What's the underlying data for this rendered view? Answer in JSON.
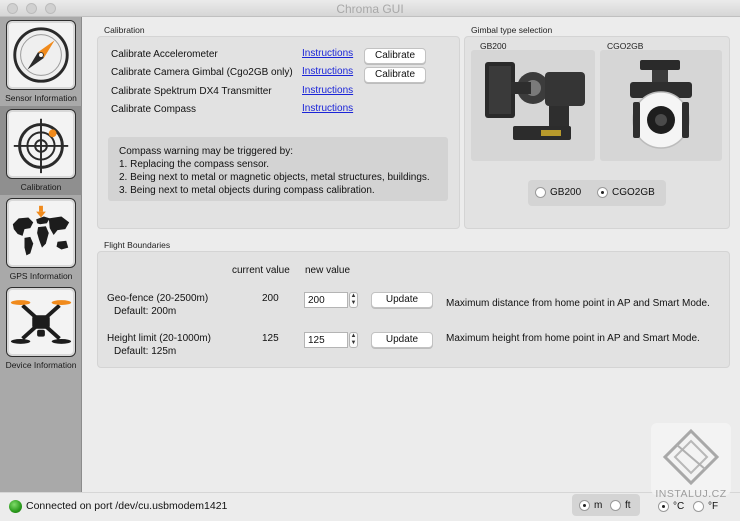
{
  "window": {
    "title": "Chroma GUI"
  },
  "sidebar": {
    "items": [
      {
        "label": "Sensor Information",
        "icon": "compass-icon"
      },
      {
        "label": "Calibration",
        "icon": "target-icon"
      },
      {
        "label": "GPS Information",
        "icon": "world-map-icon"
      },
      {
        "label": "Device Information",
        "icon": "drone-icon"
      }
    ],
    "active_index": 1
  },
  "calibration": {
    "label": "Calibration",
    "rows": [
      {
        "label": "Calibrate Accelerometer",
        "link": "Instructions",
        "button": "Calibrate"
      },
      {
        "label": "Calibrate Camera Gimbal (Cgo2GB only)",
        "link": "Instructions",
        "button": "Calibrate"
      },
      {
        "label": "Calibrate Spektrum DX4 Transmitter",
        "link": "Instructions"
      },
      {
        "label": "Calibrate Compass",
        "link": "Instructions"
      }
    ],
    "warning": {
      "title": "Compass warning may be triggered by:",
      "lines": [
        "1. Replacing the compass sensor.",
        "2. Being next to metal or magnetic objects, metal structures, buildings.",
        "3. Being next to metal objects during compass calibration."
      ]
    }
  },
  "gimbal": {
    "label": "Gimbal type selection",
    "options": [
      {
        "title": "GB200",
        "radio_label": "GB200",
        "selected": false
      },
      {
        "title": "CGO2GB",
        "radio_label": "CGO2GB",
        "selected": true
      }
    ]
  },
  "flight_boundaries": {
    "label": "Flight Boundaries",
    "col_current": "current value",
    "col_new": "new value",
    "rows": [
      {
        "label": "Geo-fence (20-2500m)",
        "default": "Default: 200m",
        "current": "200",
        "new_value": "200",
        "button": "Update",
        "description": "Maximum distance from home point in AP and Smart Mode."
      },
      {
        "label": "Height limit (20-1000m)",
        "default": "Default: 125m",
        "current": "125",
        "new_value": "125",
        "button": "Update",
        "description": "Maximum height from home point in AP and Smart Mode."
      }
    ]
  },
  "units": {
    "distance": [
      {
        "label": "m",
        "selected": true
      },
      {
        "label": "ft",
        "selected": false
      }
    ],
    "temperature": [
      {
        "label": "°C",
        "selected": true
      },
      {
        "label": "°F",
        "selected": false
      }
    ]
  },
  "status": {
    "text": "Connected on port /dev/cu.usbmodem1421",
    "led_color": "#2a9a1c"
  },
  "watermark": {
    "text": "INSTALUJ.CZ"
  },
  "colors": {
    "link": "#1a24d8",
    "accent_orange": "#f08a1c"
  }
}
